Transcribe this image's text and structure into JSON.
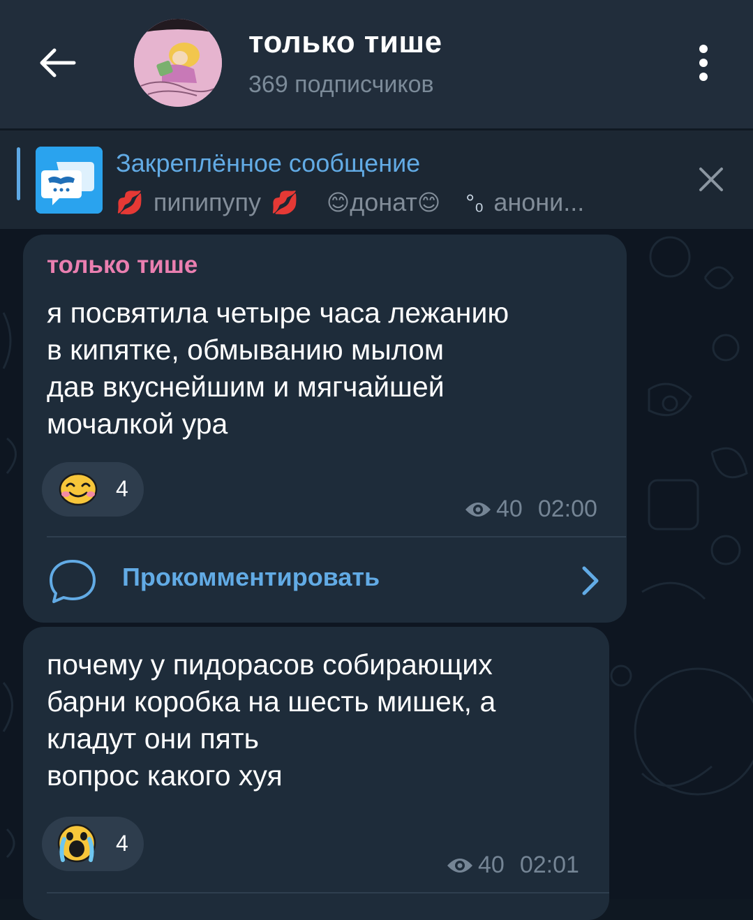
{
  "header": {
    "title": "только тише",
    "subtitle": "369 подписчиков"
  },
  "pinned": {
    "title": "Закреплённое сообщение",
    "preview_parts": [
      "пипипупу",
      "донат",
      "анони..."
    ]
  },
  "messages": [
    {
      "author": "только тише",
      "text": "я посвятила четыре часа лежанию\nв кипятке, обмыванию мылом\nдав вкуснейшим и мягчайшей\nмочалкой ура",
      "reaction_count": "4",
      "views": "40",
      "time": "02:00",
      "comment_label": "Прокомментировать"
    },
    {
      "text": "почему у пидорасов собирающих\nбарни коробка на шесть мишек, а\nкладут они пять\nвопрос какого хуя",
      "reaction_count": "4",
      "views": "40",
      "time": "02:01"
    }
  ],
  "colors": {
    "header_bg": "#212d3b",
    "accent": "#62abe5",
    "author": "#ea7fb0",
    "bubble": "#1e2c3a"
  },
  "icons": [
    "back-arrow-icon",
    "more-vertical-icon",
    "close-icon",
    "comment-bubble-icon",
    "chevron-right-icon",
    "eye-icon",
    "kiss-mark-icon",
    "smiling-face-icon",
    "bubbles-icon",
    "crying-face-icon"
  ]
}
